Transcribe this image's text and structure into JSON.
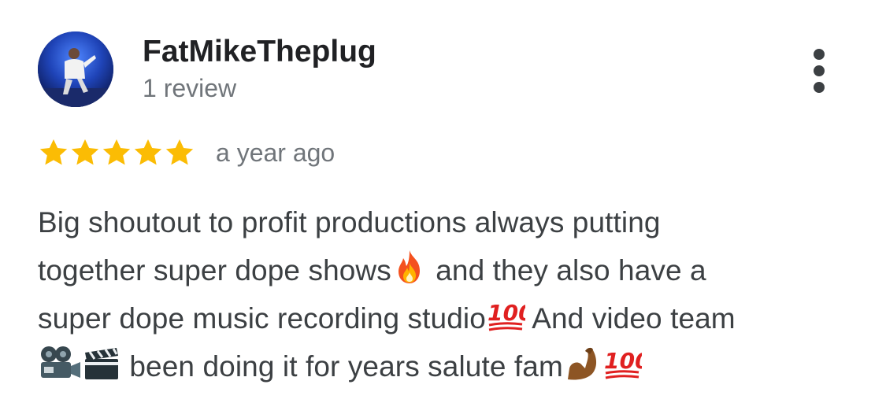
{
  "reviewer": {
    "name": "FatMikeTheplug",
    "review_count": "1 review",
    "avatar": "reviewer-avatar-photo"
  },
  "menu": {
    "icon": "more-vert-icon"
  },
  "rating": {
    "stars": 5,
    "max_stars": 5,
    "star_color": "#fbbc04",
    "time_ago": "a year ago"
  },
  "review": {
    "lines": [
      {
        "text_a": "Big shoutout to profit productions always putting"
      },
      {
        "text_a": "together super dope shows",
        "emoji_1": "fire-emoji",
        "text_b": " and they also have a"
      },
      {
        "text_a": "super dope music recording studio",
        "emoji_1": "hundred-points-emoji",
        "text_b": " And video team"
      },
      {
        "emoji_1": "movie-camera-emoji",
        "emoji_2": "clapper-board-emoji",
        "text_b": " been doing it for years salute fam",
        "emoji_3": "flexed-biceps-emoji",
        "emoji_4": "hundred-points-emoji"
      }
    ]
  },
  "colors": {
    "name_text": "#202124",
    "secondary_text": "#70757a",
    "body_text": "#3c4043"
  }
}
